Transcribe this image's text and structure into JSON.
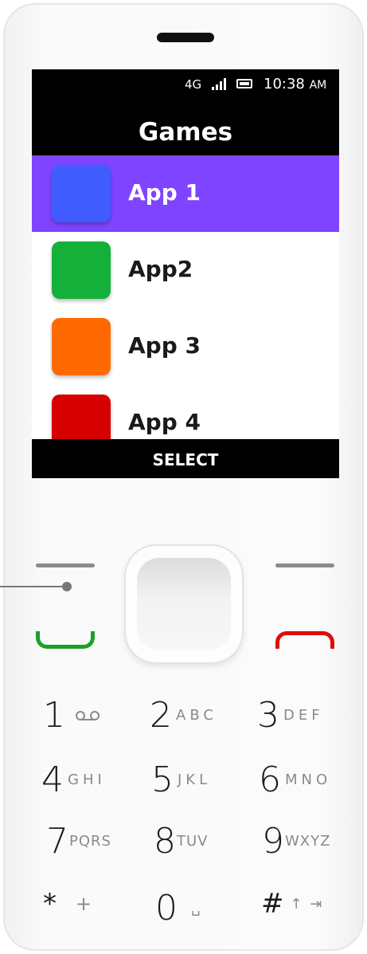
{
  "status": {
    "network": "4G",
    "time": "10:38",
    "ampm": "AM"
  },
  "header": {
    "title": "Games"
  },
  "apps": [
    {
      "label": "App 1",
      "color": "#3f5cff",
      "selected": true
    },
    {
      "label": "App2",
      "color": "#14b03a",
      "selected": false
    },
    {
      "label": "App 3",
      "color": "#ff6a00",
      "selected": false
    },
    {
      "label": "App 4",
      "color": "#d60000",
      "selected": false
    }
  ],
  "softkey": {
    "center": "SELECT"
  },
  "colors": {
    "accent": "#7f44ff",
    "call_green": "#1aa02a",
    "end_red": "#e00b0b"
  },
  "keypad": [
    {
      "num": "1",
      "sub": "",
      "icon": "voicemail-icon"
    },
    {
      "num": "2",
      "sub": "ABC"
    },
    {
      "num": "3",
      "sub": "DEF"
    },
    {
      "num": "4",
      "sub": "GHI"
    },
    {
      "num": "5",
      "sub": "JKL"
    },
    {
      "num": "6",
      "sub": "MNO"
    },
    {
      "num": "7",
      "sub": "PQRS"
    },
    {
      "num": "8",
      "sub": "TUV"
    },
    {
      "num": "9",
      "sub": "WXYZ"
    },
    {
      "num": "*",
      "sub": "+"
    },
    {
      "num": "0",
      "sub": "␣"
    },
    {
      "num": "#",
      "sub": "↑ ⇥"
    }
  ]
}
